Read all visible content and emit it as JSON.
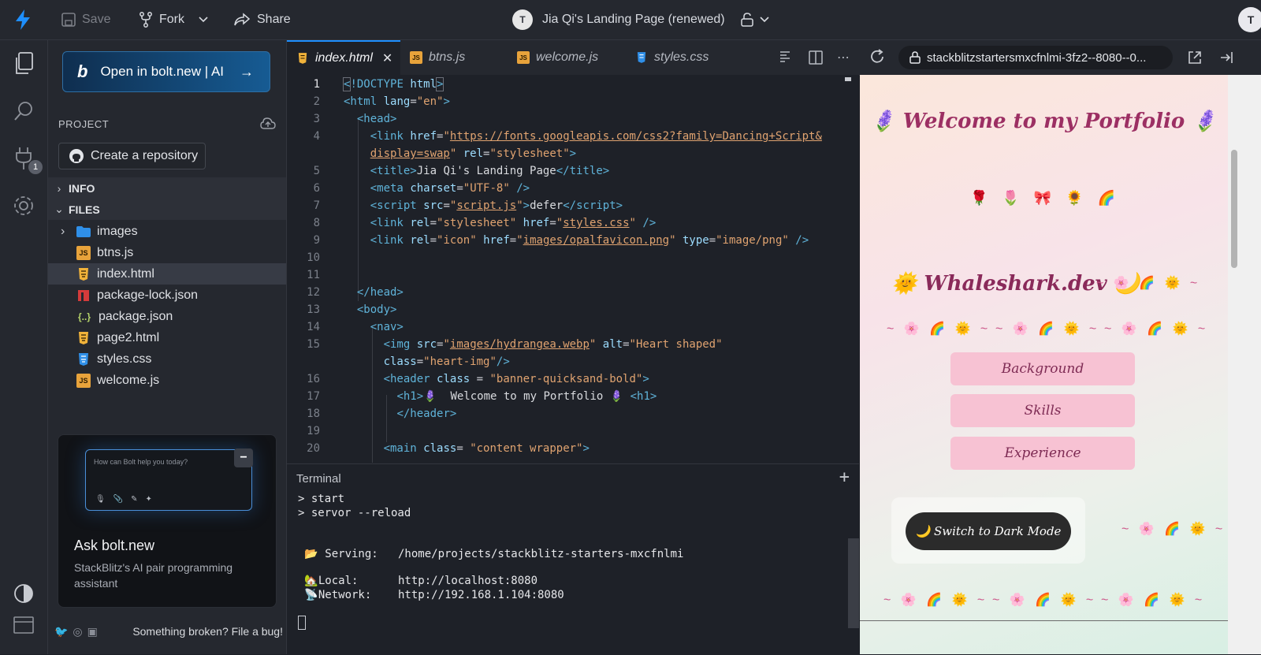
{
  "topbar": {
    "save_label": "Save",
    "fork_label": "Fork",
    "share_label": "Share",
    "project_title": "Jia Qi's Landing Page (renewed)"
  },
  "sidebar": {
    "bolt_button_label": "Open in bolt.new | AI",
    "project_heading": "PROJECT",
    "create_repo_label": "Create a repository",
    "info_heading": "INFO",
    "files_heading": "FILES",
    "files": [
      {
        "name": "images",
        "type": "folder"
      },
      {
        "name": "btns.js",
        "type": "js"
      },
      {
        "name": "index.html",
        "type": "html"
      },
      {
        "name": "package-lock.json",
        "type": "lock"
      },
      {
        "name": "package.json",
        "type": "json"
      },
      {
        "name": "page2.html",
        "type": "html"
      },
      {
        "name": "styles.css",
        "type": "css"
      },
      {
        "name": "welcome.js",
        "type": "js"
      }
    ],
    "ask_card": {
      "placeholder": "How can Bolt help you today?",
      "title": "Ask bolt.new",
      "description": "StackBlitz's AI pair programming assistant"
    },
    "footer_link": "Something broken? File a bug!",
    "activity_badge": "1"
  },
  "editor": {
    "tabs": [
      {
        "label": "index.html",
        "active": true
      },
      {
        "label": "btns.js",
        "active": false
      },
      {
        "label": "welcome.js",
        "active": false
      },
      {
        "label": "styles.css",
        "active": false
      }
    ],
    "line_numbers": [
      "1",
      "2",
      "3",
      "4",
      "5",
      "6",
      "7",
      "8",
      "9",
      "10",
      "11",
      "12",
      "13",
      "14",
      "15",
      "16",
      "17",
      "18",
      "19",
      "20"
    ]
  },
  "terminal": {
    "title": "Terminal",
    "lines": [
      "> start",
      "> servor --reload",
      "",
      " 📂 Serving:   /home/projects/stackblitz-starters-mxcfnlmi",
      "",
      " 🏡Local:      http://localhost:8080",
      " 📡Network:    http://192.168.1.104:8080"
    ]
  },
  "preview": {
    "url": "stackblitzstartersmxcfnlmi-3fz2--8080--0...",
    "title": "🪻 Welcome to my Portfolio 🪻",
    "emoji_row": "🌹🌷🎀🌻🌈",
    "brand": "🌞 Whaleshark.dev 🌙",
    "deco": "~ 🌸 🌈 🌞 ~",
    "buttons": [
      "Background",
      "Skills",
      "Experience"
    ],
    "dark_mode_label": "🌙 Switch to Dark Mode"
  },
  "colors": {
    "accent": "#1e8fff",
    "bolt_gradient_start": "#0f2e4f",
    "bolt_gradient_end": "#165b93",
    "preview_button": "#f7c2d3"
  }
}
